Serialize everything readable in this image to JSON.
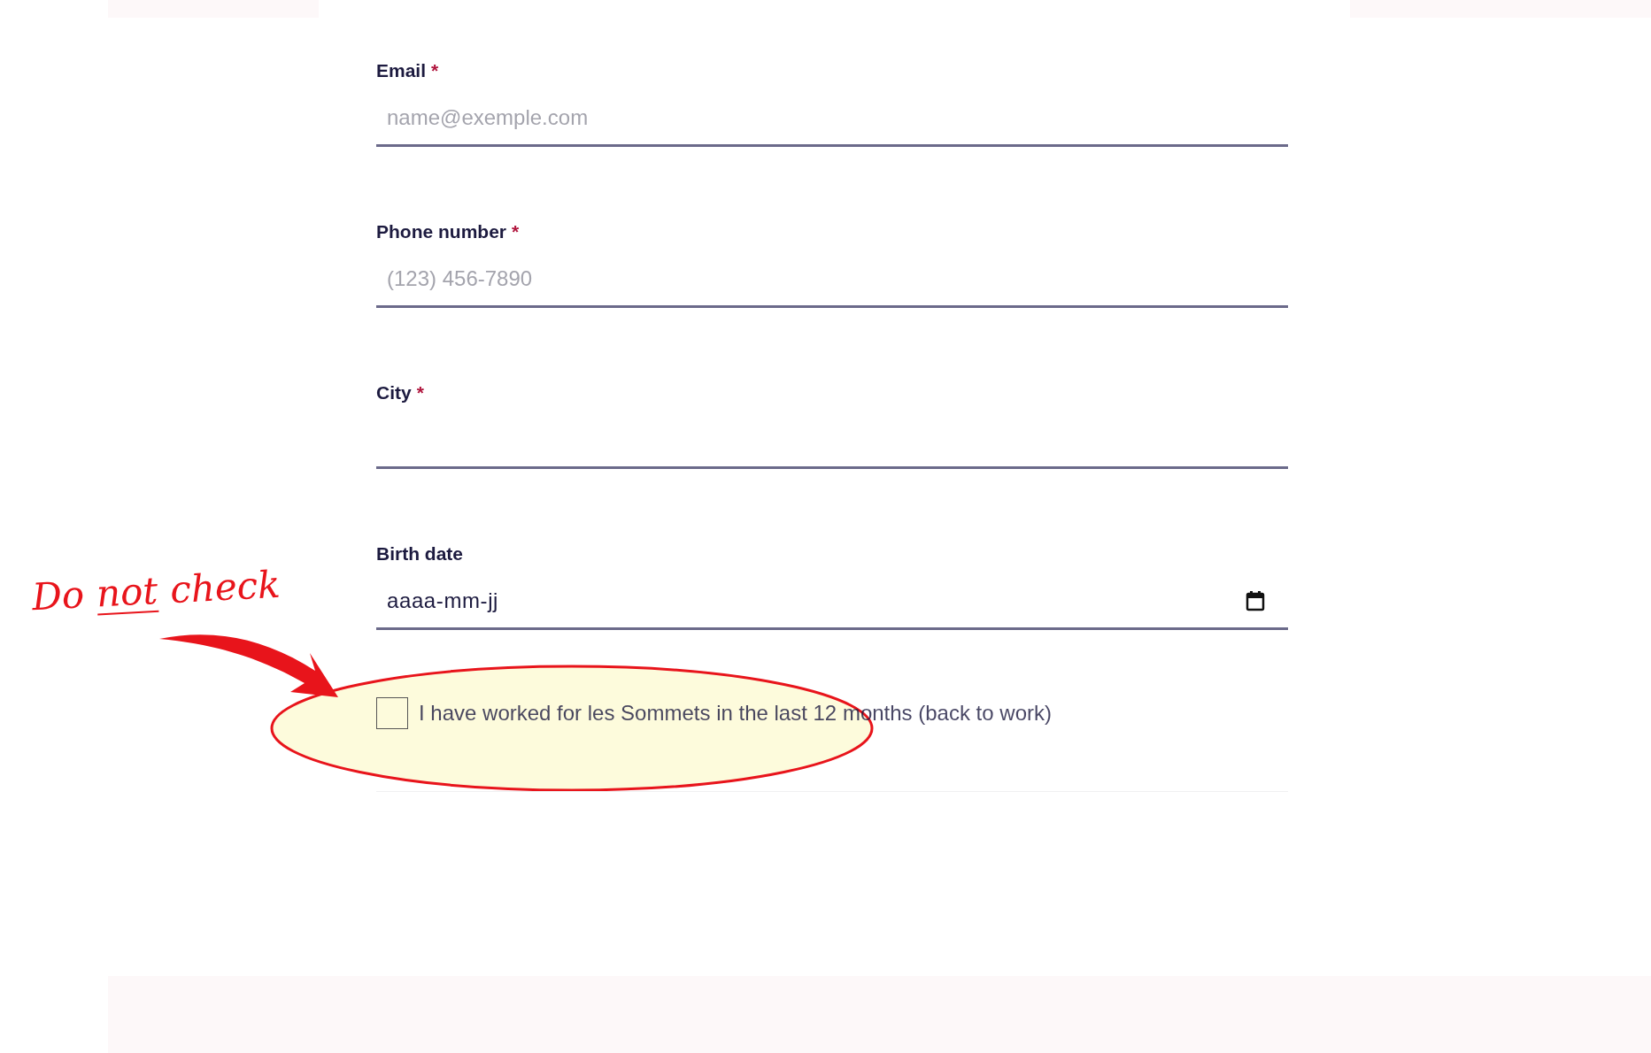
{
  "fields": [
    {
      "kind": "text",
      "label": "Email",
      "required_mark": "*",
      "placeholder": "name@exemple.com"
    },
    {
      "kind": "text",
      "label": "Phone number",
      "required_mark": "*",
      "placeholder": "(123) 456-7890"
    },
    {
      "kind": "text",
      "label": "City",
      "required_mark": "*"
    },
    {
      "kind": "date",
      "label": "Birth date",
      "value": "aaaa-mm-jj"
    }
  ],
  "consent": {
    "label": "I have worked for les Sommets in the last 12 months (back to work)",
    "checked": false
  },
  "annotation": {
    "words": [
      {
        "text": "Do",
        "underlined": false
      },
      {
        "text": "not",
        "underlined": true
      },
      {
        "text": "check",
        "underlined": false
      }
    ]
  }
}
